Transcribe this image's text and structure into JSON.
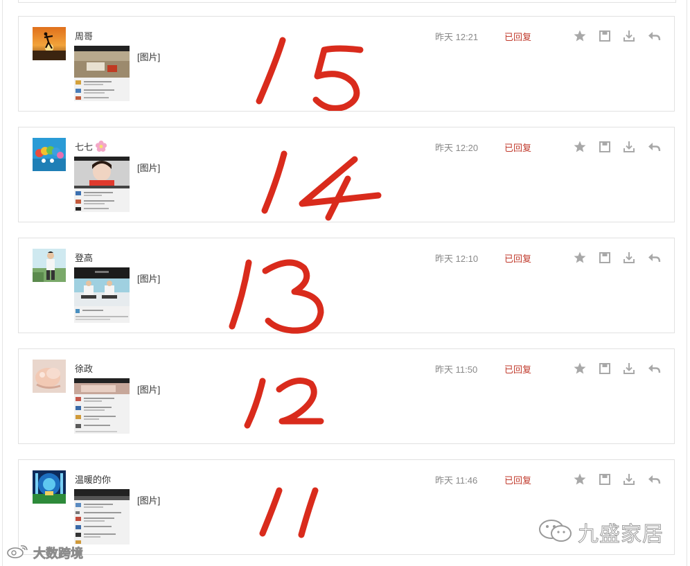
{
  "messages": [
    {
      "sender": "周哥",
      "has_flower_emoji": false,
      "content": "[图片]",
      "time": "昨天 12:21",
      "status": "已回复",
      "annotation": "15"
    },
    {
      "sender": "七七",
      "has_flower_emoji": true,
      "content": "[图片]",
      "time": "昨天 12:20",
      "status": "已回复",
      "annotation": "14"
    },
    {
      "sender": "登高",
      "has_flower_emoji": false,
      "content": "[图片]",
      "time": "昨天 12:10",
      "status": "已回复",
      "annotation": "13"
    },
    {
      "sender": "徐政",
      "has_flower_emoji": false,
      "content": "[图片]",
      "time": "昨天 11:50",
      "status": "已回复",
      "annotation": "12"
    },
    {
      "sender": "温暖的你",
      "has_flower_emoji": false,
      "content": "[图片]",
      "time": "昨天 11:46",
      "status": "已回复",
      "annotation": "11"
    }
  ],
  "actions": [
    "star-icon",
    "save-icon",
    "download-icon",
    "reply-icon"
  ],
  "watermark_right": "九盛家居",
  "watermark_left": "大数跨境",
  "colors": {
    "status": "#c0392b",
    "annotation_ink": "#d92b1c",
    "border": "#e1e1e1",
    "icon": "#a8a8a8"
  }
}
